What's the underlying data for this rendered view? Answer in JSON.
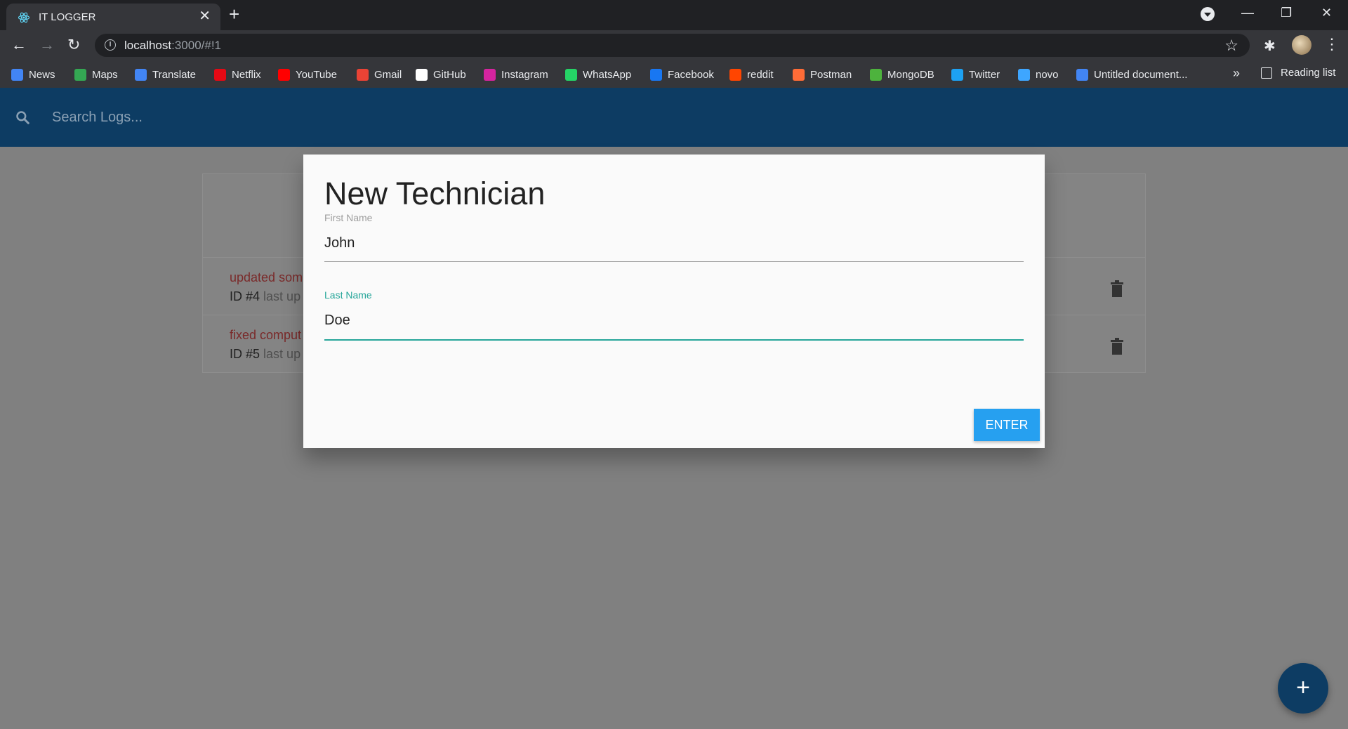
{
  "browser": {
    "tab_title": "IT LOGGER",
    "tab_close": "✕",
    "new_tab": "+",
    "url_host": "localhost",
    "url_path": ":3000/#!1",
    "window_controls": {
      "minimize": "—",
      "maximize": "❐",
      "close": "✕"
    },
    "bookmarks": [
      {
        "label": "News",
        "color": "#4285f4"
      },
      {
        "label": "Maps",
        "color": "#34a853"
      },
      {
        "label": "Translate",
        "color": "#4285f4"
      },
      {
        "label": "Netflix",
        "color": "#e50914"
      },
      {
        "label": "YouTube",
        "color": "#ff0000"
      },
      {
        "label": "Gmail",
        "color": "#ea4335"
      },
      {
        "label": "GitHub",
        "color": "#ffffff"
      },
      {
        "label": "Instagram",
        "color": "#d6249f"
      },
      {
        "label": "WhatsApp",
        "color": "#25d366"
      },
      {
        "label": "Facebook",
        "color": "#1877f2"
      },
      {
        "label": "reddit",
        "color": "#ff4500"
      },
      {
        "label": "Postman",
        "color": "#ff6c37"
      },
      {
        "label": "MongoDB",
        "color": "#4db33d"
      },
      {
        "label": "Twitter",
        "color": "#1da1f2"
      },
      {
        "label": "novo",
        "color": "#3ea6ff"
      },
      {
        "label": "Untitled document...",
        "color": "#4285f4"
      }
    ],
    "bookmarks_more": "»",
    "reading_list": "Reading list"
  },
  "app": {
    "search_placeholder": "Search Logs...",
    "logs": [
      {
        "message": "updated som",
        "id_text": "ID #4",
        "meta": "last up"
      },
      {
        "message": "fixed comput",
        "id_text": "ID #5",
        "meta": "last up"
      }
    ],
    "fab_label": "+"
  },
  "modal": {
    "title": "New Technician",
    "first_name_label": "First Name",
    "first_name_value": "John",
    "last_name_label": "Last Name",
    "last_name_value": "Doe",
    "enter_label": "ENTER"
  },
  "colors": {
    "header": "#0d3c63",
    "accent": "#26a69a",
    "button": "#26a0f0"
  }
}
